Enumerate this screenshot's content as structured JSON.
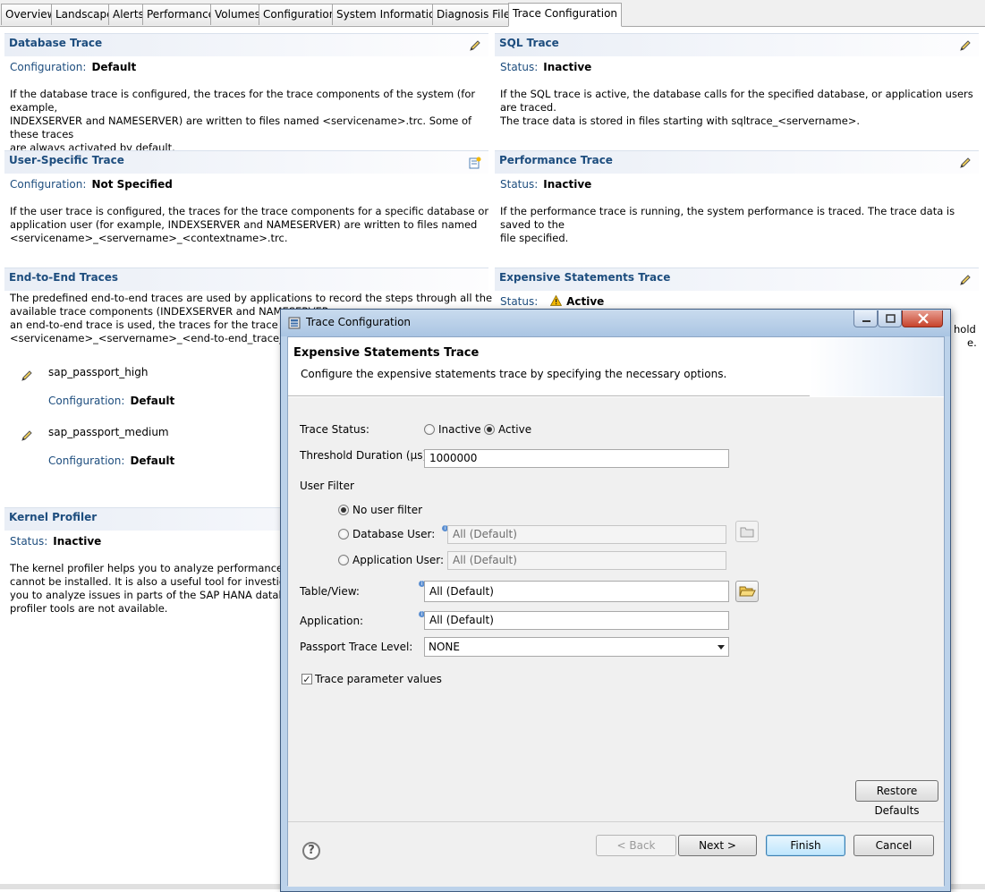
{
  "tabs": [
    "Overview",
    "Landscape",
    "Alerts",
    "Performance",
    "Volumes",
    "Configuration",
    "System Information",
    "Diagnosis Files",
    "Trace Configuration"
  ],
  "database_trace": {
    "title": "Database Trace",
    "label": "Configuration:",
    "value": "Default",
    "desc1": "If the database trace is configured, the traces for the trace components of the system (for example,",
    "desc2": "INDEXSERVER and NAMESERVER) are written to files named <servicename>.trc. Some of these traces",
    "desc3": "are always activated by default."
  },
  "sql_trace": {
    "title": "SQL Trace",
    "label": "Status:",
    "value": "Inactive",
    "desc1": "If the SQL trace is active, the database calls for the specified database, or application users are traced.",
    "desc2": "The trace data is stored in files starting with sqltrace_<servername>."
  },
  "user_trace": {
    "title": "User-Specific Trace",
    "label": "Configuration:",
    "value": "Not Specified",
    "desc1": "If the user trace is configured, the traces for the trace components for a specific database or",
    "desc2": "application user (for example, INDEXSERVER and NAMESERVER) are written to files named",
    "desc3": "<servicename>_<servername>_<contextname>.trc."
  },
  "performance_trace": {
    "title": "Performance Trace",
    "label": "Status:",
    "value": "Inactive",
    "desc1": "If the performance trace is running, the system performance is traced. The trace data is saved to the",
    "desc2": "file specified."
  },
  "e2e_trace": {
    "title": "End-to-End Traces",
    "desc1": "The predefined end-to-end traces are used by applications to record the steps through all the",
    "desc2": "available trace components (INDEXSERVER and NAMESERVER",
    "desc3": "an end-to-end trace is used, the traces for the trace comp",
    "desc4": "<servicename>_<servername>_<end-to-end_trace_name",
    "items": [
      {
        "name": "sap_passport_high",
        "label": "Configuration:",
        "value": "Default"
      },
      {
        "name": "sap_passport_medium",
        "label": "Configuration:",
        "value": "Default"
      }
    ]
  },
  "expensive_trace": {
    "title": "Expensive Statements Trace",
    "label": "Status:",
    "value": "Active",
    "peek1": "hold",
    "peek2": "e."
  },
  "kernel_profiler": {
    "title": "Kernel Profiler",
    "label": "Status:",
    "value": "Inactive",
    "desc1": "The kernel profiler helps you to analyze performance issue",
    "desc2": "cannot be installed. It is also a useful tool for investigating",
    "desc3": "you to analyze issues in parts of the SAP HANA database w",
    "desc4": "profiler tools are not available."
  },
  "dialog": {
    "window_title": "Trace Configuration",
    "header_title": "Expensive Statements Trace",
    "header_sub": "Configure the expensive statements trace by specifying the necessary options.",
    "trace_status_label": "Trace Status:",
    "status_inactive": "Inactive",
    "status_active": "Active",
    "status_selected": "Active",
    "threshold_label": "Threshold Duration (µs):",
    "threshold_value": "1000000",
    "user_filter_label": "User Filter",
    "no_user_filter": "No user filter",
    "database_user_label": "Database User:",
    "database_user_value": "All (Default)",
    "application_user_label": "Application User:",
    "application_user_value": "All (Default)",
    "user_filter_selected": "No user filter",
    "table_view_label": "Table/View:",
    "table_view_value": "All (Default)",
    "application_label": "Application:",
    "application_value": "All (Default)",
    "passport_label": "Passport Trace Level:",
    "passport_value": "NONE",
    "trace_param_label": "Trace parameter values",
    "trace_param_checked": true,
    "restore_defaults": "Restore Defaults",
    "back": "< Back",
    "next": "Next >",
    "finish": "Finish",
    "cancel": "Cancel",
    "help": "?"
  },
  "colors": {
    "panel_title": "#1d4d7e",
    "dialog_frame": "#bcd2ea",
    "warning": "#f2b705"
  }
}
